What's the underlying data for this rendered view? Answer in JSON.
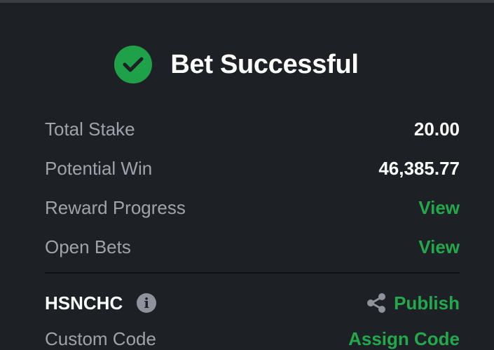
{
  "header": {
    "title": "Bet Successful"
  },
  "summary": {
    "total_stake_label": "Total Stake",
    "total_stake_value": "20.00",
    "potential_win_label": "Potential Win",
    "potential_win_value": "46,385.77",
    "reward_progress_label": "Reward Progress",
    "reward_progress_link": "View",
    "open_bets_label": "Open Bets",
    "open_bets_link": "View"
  },
  "booking": {
    "code": "HSNCHC",
    "publish_label": "Publish"
  },
  "partial_row": {
    "label": "Custom Code",
    "link": "Assign Code"
  },
  "colors": {
    "background": "#1d2025",
    "accent_green": "#23a94c",
    "label_gray": "#9fa3ab",
    "text_white": "#ffffff"
  },
  "icons": {
    "success": "check-circle-icon",
    "info": "info-icon",
    "share": "share-icon"
  }
}
